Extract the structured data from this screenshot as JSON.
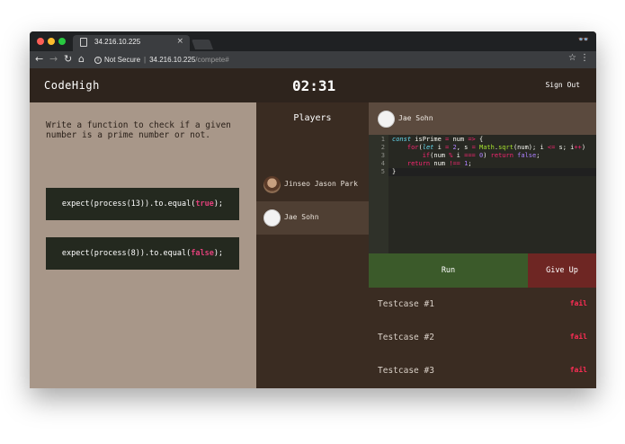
{
  "browser": {
    "tab_title": "34.216.10.225",
    "tab_close": "×",
    "security_label": "Not Secure",
    "url_host": "34.216.10.225",
    "url_path": "/compete#",
    "info_glyph": "i",
    "nav": {
      "back": "←",
      "forward": "→",
      "reload": "↻",
      "home": "⌂"
    },
    "star": "☆",
    "menu": "⋮",
    "incognito": "👓",
    "traffic_lights": [
      "#fc5f57",
      "#fdbc2e",
      "#28c840"
    ]
  },
  "header": {
    "logo": "CodeHigh",
    "timer": "02:31",
    "signout_label": "Sign Out"
  },
  "problem": {
    "prompt": "Write a function to check if a given number is a prime number or not.",
    "expectations": [
      {
        "prefix": "expect(process(13)).to.equal(",
        "value": "true",
        "suffix": ");"
      },
      {
        "prefix": "expect(process(8)).to.equal(",
        "value": "false",
        "suffix": ");"
      }
    ]
  },
  "players": {
    "title": "Players",
    "list": [
      {
        "name": "Jinseo Jason Park"
      },
      {
        "name": "Jae Sohn"
      }
    ]
  },
  "editor": {
    "owner": "Jae Sohn",
    "line_numbers": [
      "1",
      "2",
      "3",
      "4",
      "5"
    ],
    "run_label": "Run",
    "giveup_label": "Give Up"
  },
  "testcases": [
    {
      "name": "Testcase #1",
      "status": "fail"
    },
    {
      "name": "Testcase #2",
      "status": "fail"
    },
    {
      "name": "Testcase #3",
      "status": "fail"
    }
  ],
  "colors": {
    "fail": "#ff2d55",
    "run": "#3b5a2a",
    "giveup": "#6e2623",
    "keyword": "#e0407a"
  }
}
